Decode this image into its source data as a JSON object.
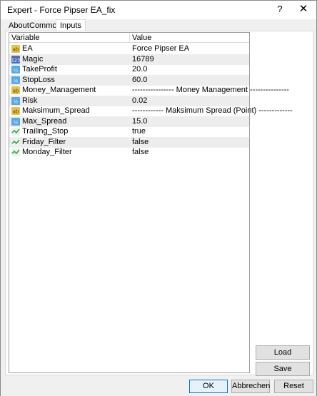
{
  "window": {
    "title": "Expert - Force Pipser EA_fix",
    "help_label": "?",
    "close_label": "✕"
  },
  "tabs": [
    {
      "label": "About",
      "active": false
    },
    {
      "label": "Common",
      "active": false
    },
    {
      "label": "Inputs",
      "active": true
    }
  ],
  "grid": {
    "columns": [
      "Variable",
      "Value"
    ],
    "rows": [
      {
        "icon": "string-icon",
        "name": "EA",
        "value": "Force Pipser EA"
      },
      {
        "icon": "integer-icon",
        "name": "Magic",
        "value": "16789"
      },
      {
        "icon": "double-icon",
        "name": "TakeProfit",
        "value": "20.0"
      },
      {
        "icon": "double-icon",
        "name": "StopLoss",
        "value": "60.0"
      },
      {
        "icon": "string-icon",
        "name": "Money_Management",
        "value": "---------------- Money Management  ---------------"
      },
      {
        "icon": "double-icon",
        "name": "Risk",
        "value": "0.02"
      },
      {
        "icon": "string-icon",
        "name": "Maksimum_Spread",
        "value": "------------ Maksimum Spread (Point) -------------"
      },
      {
        "icon": "double-icon",
        "name": "Max_Spread",
        "value": "15.0"
      },
      {
        "icon": "bool-icon",
        "name": "Trailing_Stop",
        "value": "true"
      },
      {
        "icon": "bool-icon",
        "name": "Friday_Filter",
        "value": "false"
      },
      {
        "icon": "bool-icon",
        "name": "Monday_Filter",
        "value": "false"
      }
    ]
  },
  "side_buttons": {
    "load": "Load",
    "save": "Save"
  },
  "footer": {
    "ok": "OK",
    "cancel": "Abbrechen",
    "reset": "Reset"
  },
  "icon_colors": {
    "string": "#e8c14a",
    "integer": "#4a6fb5",
    "double": "#5aa9e6",
    "bool": "#3aa84a"
  }
}
